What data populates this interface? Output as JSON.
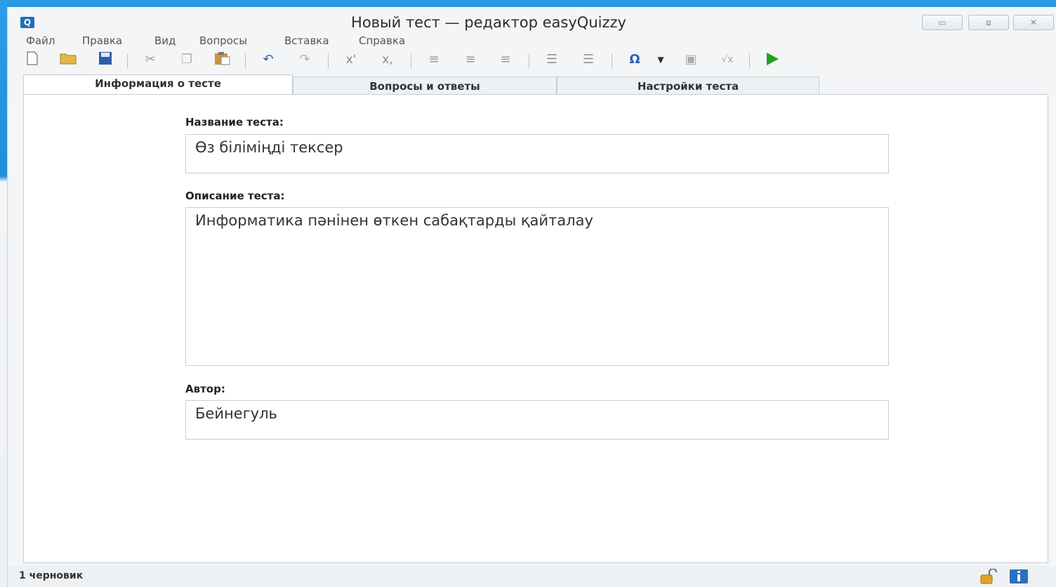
{
  "window": {
    "title": "Новый тест — редактор easyQuizzy",
    "app_icon_letter": "Q"
  },
  "menu": {
    "items": [
      {
        "label": "Файл"
      },
      {
        "label": "Правка"
      },
      {
        "label": "Вид"
      },
      {
        "label": "Вопросы"
      },
      {
        "label": "Вставка"
      },
      {
        "label": "Справка"
      }
    ]
  },
  "toolbar": {
    "superscript_label": "x'",
    "subscript_label": "x,",
    "symbol_label": "Ω",
    "run_color": "#22a022"
  },
  "tabs": [
    {
      "label": "Информация о тесте",
      "active": true
    },
    {
      "label": "Вопросы и ответы",
      "active": false
    },
    {
      "label": "Настройки теста",
      "active": false
    }
  ],
  "form": {
    "name_label": "Название теста:",
    "name_value": "Өз біліміңді тексер",
    "description_label": "Описание теста:",
    "description_value": "Информатика пәнінен өткен сабақтарды қайталау",
    "author_label": "Автор:",
    "author_value": "Бейнегуль"
  },
  "status": {
    "text": "1 черновик"
  }
}
